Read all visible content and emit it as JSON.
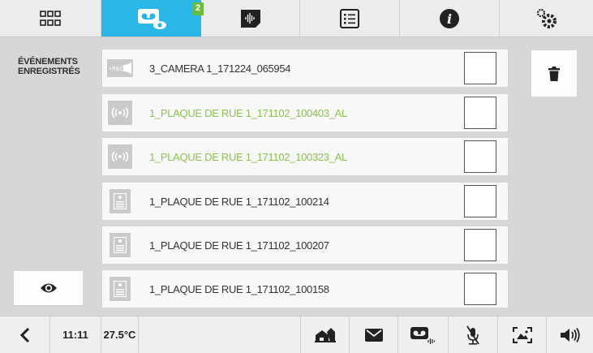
{
  "topbar": {
    "tabs": [
      {
        "name": "apps",
        "icon": "grid-icon"
      },
      {
        "name": "recordings",
        "icon": "voicemail-eye-icon",
        "badge": "2",
        "active": true
      },
      {
        "name": "audio-messages",
        "icon": "audio-message-icon"
      },
      {
        "name": "list",
        "icon": "list-icon"
      },
      {
        "name": "info",
        "icon": "info-icon"
      },
      {
        "name": "settings",
        "icon": "gears-icon"
      }
    ]
  },
  "side": {
    "title_line1": "ÉVÉNEMENTS",
    "title_line2": "ENREGISTRÉS",
    "eye_icon": "eye-icon",
    "trash_icon": "trash-icon"
  },
  "events": [
    {
      "type": "camera-rec",
      "icon": "rec-camera-icon",
      "label": "3_CAMERA 1_171224_065954",
      "alarm": false
    },
    {
      "type": "alarm",
      "icon": "alarm-signal-icon",
      "label": "1_PLAQUE DE RUE 1_171102_100403_AL",
      "alarm": true
    },
    {
      "type": "alarm",
      "icon": "alarm-signal-icon",
      "label": "1_PLAQUE DE RUE 1_171102_100323_AL",
      "alarm": true
    },
    {
      "type": "doorplate",
      "icon": "door-panel-icon",
      "label": "1_PLAQUE DE RUE 1_171102_100214",
      "alarm": false
    },
    {
      "type": "doorplate",
      "icon": "door-panel-icon",
      "label": "1_PLAQUE DE RUE 1_171102_100207",
      "alarm": false
    },
    {
      "type": "doorplate",
      "icon": "door-panel-icon",
      "label": "1_PLAQUE DE RUE 1_171102_100158",
      "alarm": false
    }
  ],
  "bottombar": {
    "back_icon": "chevron-left-icon",
    "time": "11:11",
    "temperature": "27.5°C",
    "icons": [
      "home-icon",
      "envelope-icon",
      "voicemail-audio-icon",
      "mic-muted-icon",
      "photo-frame-icon",
      "speaker-icon"
    ]
  },
  "colors": {
    "accent": "#2bb6e8",
    "badge": "#6dbb3e",
    "alarm_text": "#8cc252"
  }
}
